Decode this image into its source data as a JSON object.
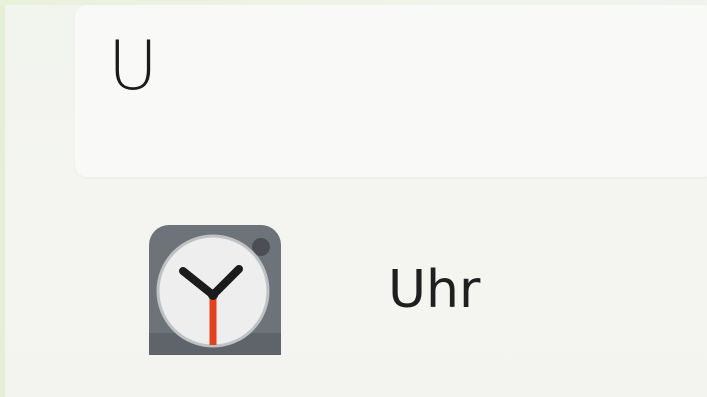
{
  "search": {
    "query": "U"
  },
  "results": [
    {
      "label": "Uhr",
      "icon": "clock-icon"
    }
  ],
  "colors": {
    "clock_hand": "#e2401f",
    "clock_body": "#6e7379"
  }
}
